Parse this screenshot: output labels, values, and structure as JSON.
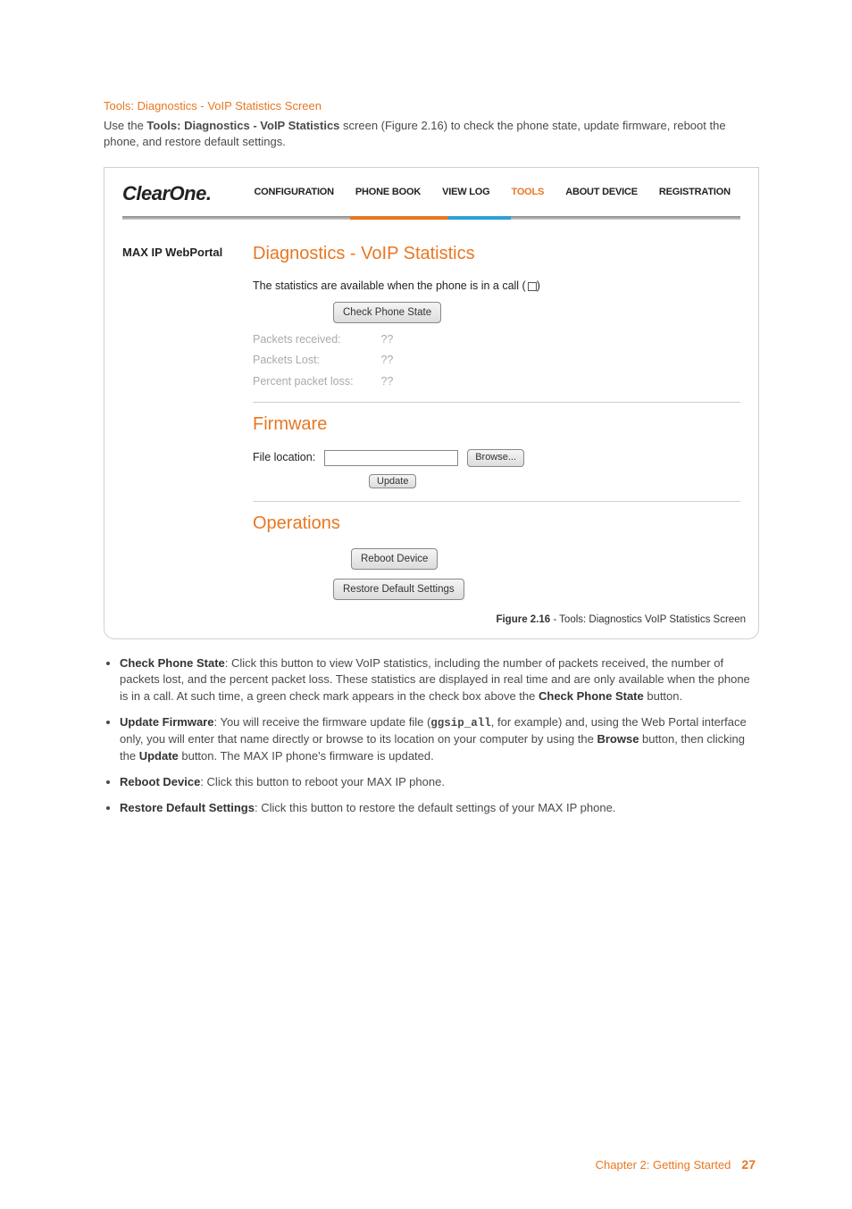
{
  "section_title": "Tools: Diagnostics - VoIP Statistics Screen",
  "intro": {
    "prefix": "Use the ",
    "bold": "Tools: Diagnostics - VoIP Statistics",
    "suffix": " screen (Figure 2.16) to check the phone state, update firmware, reboot the phone, and restore default settings."
  },
  "portal": {
    "logo": "ClearOne.",
    "nav": [
      "CONFIGURATION",
      "PHONE BOOK",
      "VIEW LOG",
      "TOOLS",
      "ABOUT DEVICE",
      "REGISTRATION"
    ],
    "active_nav_index": 3,
    "side_label": "MAX IP WebPortal",
    "diag": {
      "heading": "Diagnostics - VoIP Statistics",
      "note_prefix": "The statistics are available when the phone is in a call (",
      "note_suffix": ")",
      "check_btn": "Check Phone State",
      "packets_received_label": "Packets received:",
      "packets_lost_label": "Packets Lost:",
      "percent_loss_label": "Percent packet loss:",
      "packets_received_value": "??",
      "packets_lost_value": "??",
      "percent_loss_value": "??"
    },
    "firmware": {
      "heading": "Firmware",
      "file_label": "File location:",
      "browse_btn": "Browse...",
      "update_btn": "Update"
    },
    "operations": {
      "heading": "Operations",
      "reboot_btn": "Reboot Device",
      "restore_btn": "Restore Default Settings"
    }
  },
  "figure_caption": {
    "bold": "Figure 2.16",
    "rest": " - Tools: Diagnostics VoIP Statistics Screen"
  },
  "bullets": [
    {
      "lead": "Check Phone State",
      "body": ": Click this button to view VoIP statistics, including the number of packets received, the number of packets lost, and the percent packet loss. These statistics are displayed in real time and are only available when the phone is in a call. At such time, a green check mark appears in the check box above the ",
      "bold2": "Check Phone State",
      "tail": " button."
    },
    {
      "lead": "Update Firmware",
      "body": ": You will receive the firmware update file (",
      "code": "ggsip_all",
      "mid": ", for example) and, using the Web Portal interface only, you will enter that name directly or browse to its location on your computer by using the ",
      "bold2": "Browse",
      "mid2": " button, then clicking the ",
      "bold3": "Update",
      "tail": " button. The MAX IP phone's firmware is updated."
    },
    {
      "lead": "Reboot Device",
      "body": ": Click this button to reboot your MAX IP phone."
    },
    {
      "lead": "Restore Default Settings",
      "body": ": Click this button to restore the default settings of your MAX IP phone."
    }
  ],
  "footer": {
    "chapter": "Chapter 2: Getting Started",
    "page": "27"
  }
}
